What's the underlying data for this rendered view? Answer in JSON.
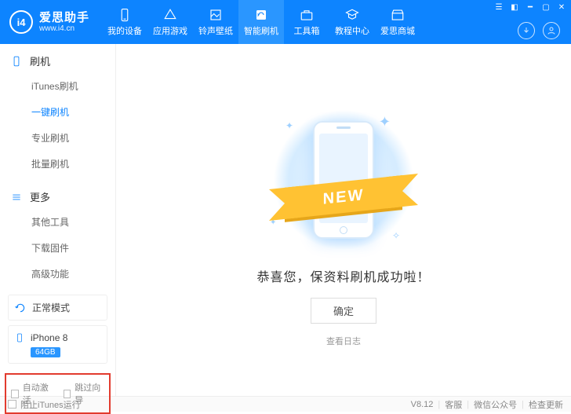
{
  "app": {
    "name_cn": "爱思助手",
    "url": "www.i4.cn",
    "logo_text": "i4"
  },
  "tabs": [
    {
      "id": "device",
      "label": "我的设备"
    },
    {
      "id": "games",
      "label": "应用游戏"
    },
    {
      "id": "ringwall",
      "label": "铃声壁纸"
    },
    {
      "id": "flash",
      "label": "智能刷机",
      "active": true
    },
    {
      "id": "toolbox",
      "label": "工具箱"
    },
    {
      "id": "tutorial",
      "label": "教程中心"
    },
    {
      "id": "store",
      "label": "爱思商城"
    }
  ],
  "sidebar": {
    "sections": [
      {
        "id": "flash",
        "title": "刷机",
        "items": [
          {
            "id": "itunes_flash",
            "label": "iTunes刷机"
          },
          {
            "id": "oneclick",
            "label": "一键刷机",
            "active": true
          },
          {
            "id": "pro_flash",
            "label": "专业刷机"
          },
          {
            "id": "batch_flash",
            "label": "批量刷机"
          }
        ]
      },
      {
        "id": "more",
        "title": "更多",
        "items": [
          {
            "id": "other_tools",
            "label": "其他工具"
          },
          {
            "id": "download_fw",
            "label": "下载固件"
          },
          {
            "id": "advanced",
            "label": "高级功能"
          }
        ]
      }
    ],
    "status_mode": "正常模式",
    "device": {
      "name": "iPhone 8",
      "capacity": "64GB"
    },
    "redbox": {
      "auto_activate": "自动激活",
      "skip_guide": "跳过向导"
    }
  },
  "content": {
    "ribbon": "NEW",
    "success_text": "恭喜您，保资料刷机成功啦！",
    "ok_button": "确定",
    "log_link": "查看日志"
  },
  "footer": {
    "block_itunes": "阻止iTunes运行",
    "version": "V8.12",
    "links": {
      "support": "客服",
      "wechat": "微信公众号",
      "check_update": "检查更新"
    }
  }
}
